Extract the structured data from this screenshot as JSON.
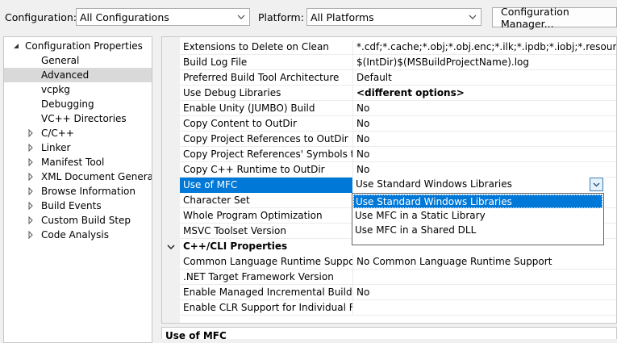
{
  "topbar": {
    "configuration_label": "Configuration:",
    "configuration_value": "All Configurations",
    "platform_label": "Platform:",
    "platform_value": "All Platforms",
    "config_manager_button": "Configuration Manager..."
  },
  "tree": {
    "root": "Configuration Properties",
    "items": [
      {
        "label": "General"
      },
      {
        "label": "Advanced",
        "selected": true
      },
      {
        "label": "vcpkg"
      },
      {
        "label": "Debugging"
      },
      {
        "label": "VC++ Directories"
      },
      {
        "label": "C/C++",
        "expandable": true
      },
      {
        "label": "Linker",
        "expandable": true
      },
      {
        "label": "Manifest Tool",
        "expandable": true
      },
      {
        "label": "XML Document Generator",
        "expandable": true
      },
      {
        "label": "Browse Information",
        "expandable": true
      },
      {
        "label": "Build Events",
        "expandable": true
      },
      {
        "label": "Custom Build Step",
        "expandable": true
      },
      {
        "label": "Code Analysis",
        "expandable": true
      }
    ]
  },
  "grid": {
    "rows": [
      {
        "name": "Extensions to Delete on Clean",
        "value": "*.cdf;*.cache;*.obj;*.obj.enc;*.ilk;*.ipdb;*.iobj;*.resources;*.t"
      },
      {
        "name": "Build Log File",
        "value": "$(IntDir)$(MSBuildProjectName).log"
      },
      {
        "name": "Preferred Build Tool Architecture",
        "value": "Default"
      },
      {
        "name": "Use Debug Libraries",
        "value": "<different options>"
      },
      {
        "name": "Enable Unity (JUMBO) Build",
        "value": "No"
      },
      {
        "name": "Copy Content to OutDir",
        "value": "No"
      },
      {
        "name": "Copy Project References to OutDir",
        "value": "No"
      },
      {
        "name": "Copy Project References' Symbols to OutDir",
        "value": "No"
      },
      {
        "name": "Copy C++ Runtime to OutDir",
        "value": "No"
      },
      {
        "name": "Use of MFC",
        "value": "Use Standard Windows Libraries"
      },
      {
        "name": "Character Set",
        "value": ""
      },
      {
        "name": "Whole Program Optimization",
        "value": ""
      },
      {
        "name": "MSVC Toolset Version",
        "value": ""
      }
    ],
    "category": "C++/CLI Properties",
    "cli_rows": [
      {
        "name": "Common Language Runtime Support",
        "value": "No Common Language Runtime Support"
      },
      {
        "name": ".NET Target Framework Version",
        "value": ""
      },
      {
        "name": "Enable Managed Incremental Build",
        "value": "No"
      },
      {
        "name": "Enable CLR Support for Individual Files",
        "value": ""
      }
    ]
  },
  "dropdown": {
    "current": "Use Standard Windows Libraries",
    "options": [
      "Use Standard Windows Libraries",
      "Use MFC in a Static Library",
      "Use MFC in a Shared DLL"
    ]
  },
  "description": {
    "title": "Use of MFC"
  },
  "colors": {
    "selection": "#0078d7",
    "tree_selection": "#d9d9d9"
  }
}
